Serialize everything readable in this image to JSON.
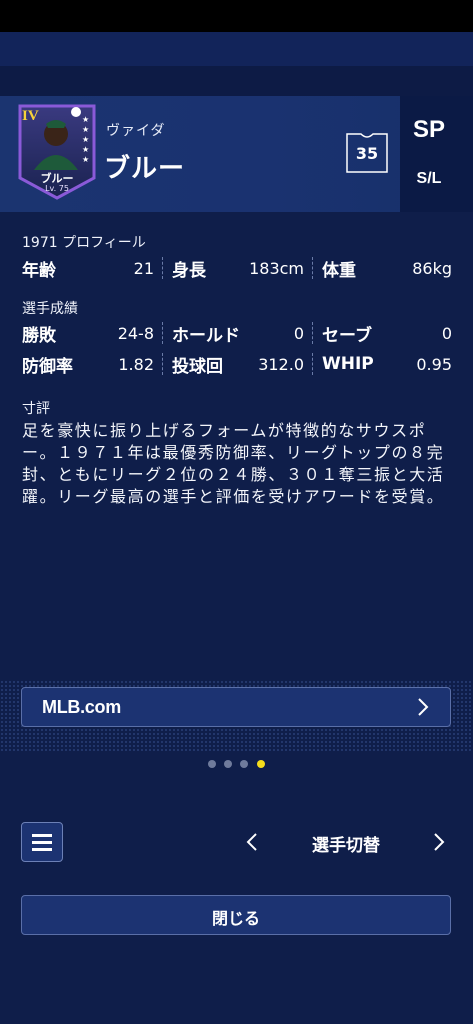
{
  "player": {
    "name_kana": "ヴァイダ",
    "name": "ブルー",
    "card_name": "ブルー",
    "card_rank": "IV",
    "card_level": "Lv. 75",
    "number": "35",
    "position": "SP",
    "bats_throws": "S/L"
  },
  "profile": {
    "label": "1971 プロフィール",
    "age_label": "年齢",
    "age": "21",
    "height_label": "身長",
    "height": "183cm",
    "weight_label": "体重",
    "weight": "86kg"
  },
  "record": {
    "label": "選手成績",
    "wl_label": "勝敗",
    "wl": "24-8",
    "hold_label": "ホールド",
    "hold": "0",
    "save_label": "セーブ",
    "save": "0",
    "era_label": "防御率",
    "era": "1.82",
    "ip_label": "投球回",
    "ip": "312.0",
    "whip_label": "WHIP",
    "whip": "0.95"
  },
  "comment": {
    "label": "寸評",
    "text": "足を豪快に振り上げるフォームが特徴的なサウスポー。１９７１年は最優秀防御率、リーグトップの８完封、ともにリーグ２位の２４勝、３０１奪三振と大活躍。リーグ最高の選手と評価を受けアワードを受賞。"
  },
  "links": {
    "mlb_label": "MLB.com"
  },
  "pager": {
    "pages": 4,
    "active": 4
  },
  "footer": {
    "switch_label": "選手切替",
    "close_label": "閉じる"
  },
  "colors": {
    "background": "#0f1e4a",
    "button": "#1c3372",
    "active_dot": "#f5dd1c",
    "card_border": "#8a5ad8"
  }
}
